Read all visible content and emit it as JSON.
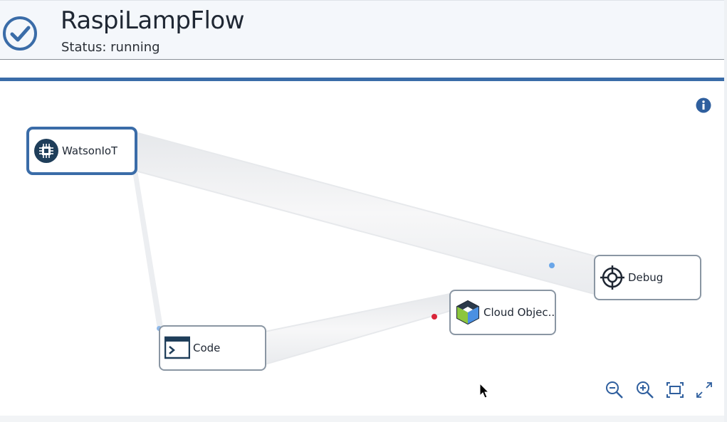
{
  "header": {
    "title": "RaspiLampFlow",
    "status": "Status: running",
    "status_icon": "check-circle-icon",
    "accent_color": "#3a6ca8"
  },
  "flow": {
    "nodes": [
      {
        "id": "watsoniot",
        "label": "WatsonIoT",
        "icon": "chip-icon",
        "selected": true
      },
      {
        "id": "code",
        "label": "Code",
        "icon": "terminal-icon",
        "selected": false
      },
      {
        "id": "cloud",
        "label": "Cloud Objec...",
        "icon": "cube-icon",
        "selected": false
      },
      {
        "id": "debug",
        "label": "Debug",
        "icon": "crosshair-icon",
        "selected": false
      }
    ],
    "edges": [
      {
        "from": "WatsonIoT",
        "to": "Debug"
      },
      {
        "from": "WatsonIoT",
        "to": "Code"
      },
      {
        "from": "Code",
        "to": "Cloud Objec..."
      }
    ],
    "port_colors": {
      "active": "#6aa6e8",
      "error": "#d9263a"
    }
  },
  "controls": {
    "info": "info-icon",
    "zoom_out": "zoom-out-icon",
    "zoom_in": "zoom-in-icon",
    "fit": "fit-to-screen-icon",
    "fullscreen": "fullscreen-icon"
  }
}
